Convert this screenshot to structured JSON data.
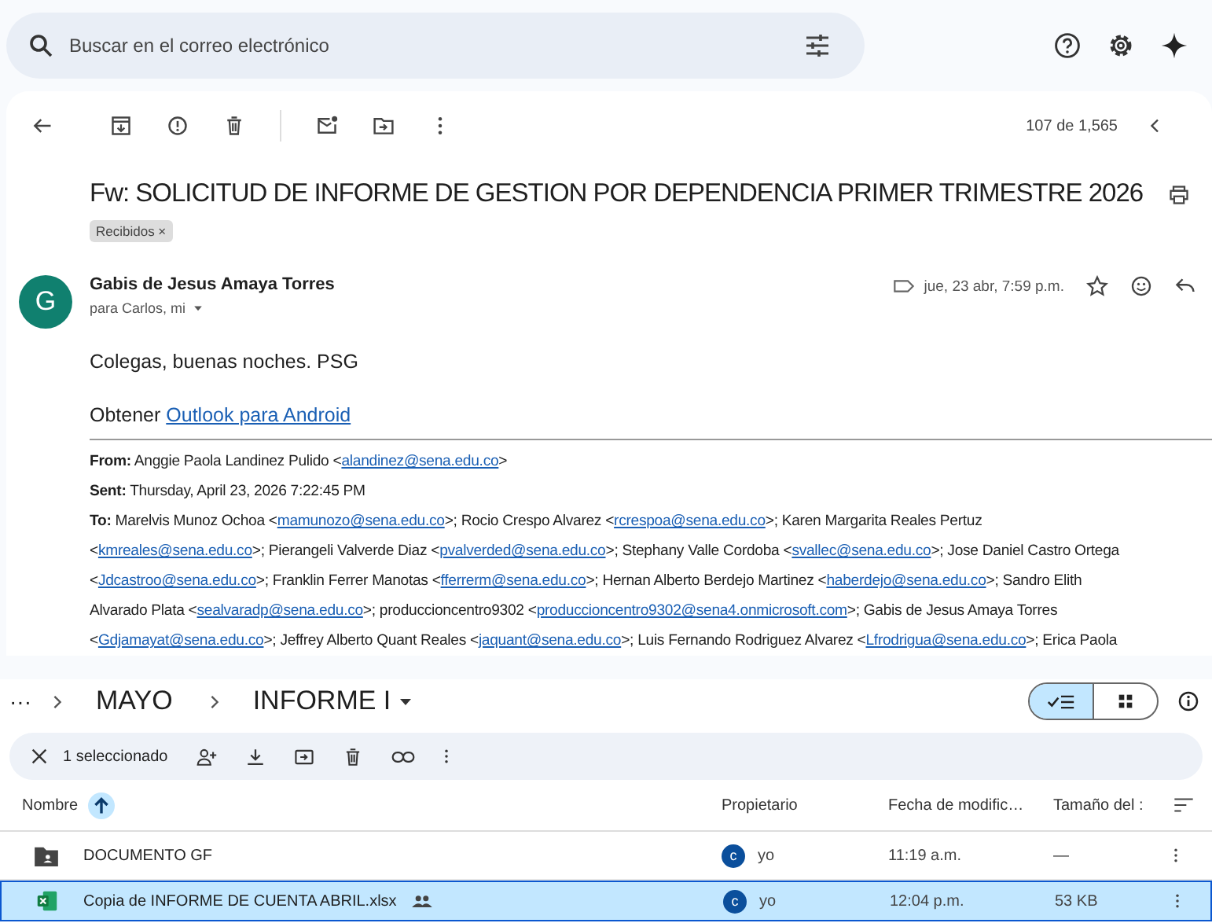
{
  "search": {
    "placeholder": "Buscar en el correo electrónico"
  },
  "toolbar": {
    "counter": "107 de 1,565"
  },
  "email": {
    "subject": "Fw: SOLICITUD DE INFORME DE GESTION POR DEPENDENCIA PRIMER TRIMESTRE 2026",
    "label_chip": {
      "label": "Recibidos",
      "close": "×"
    },
    "sender": {
      "avatar": "G",
      "name": "Gabis de Jesus Amaya Torres",
      "recipients": "para Carlos, mi",
      "date": "jue, 23 abr, 7:59 p.m."
    },
    "greeting": "Colegas, buenas noches. PSG",
    "signature": [
      {
        "kind": "text",
        "text": "Obtener "
      },
      {
        "kind": "link",
        "text": "Outlook para Android"
      }
    ],
    "forward_header": [
      [
        {
          "kind": "label",
          "text": "From:"
        },
        {
          "kind": "text",
          "text": " Anggie Paola Landinez Pulido <"
        },
        {
          "kind": "link",
          "text": "alandinez@sena.edu.co"
        },
        {
          "kind": "text",
          "text": ">"
        }
      ],
      [
        {
          "kind": "label",
          "text": "Sent:"
        },
        {
          "kind": "text",
          "text": " Thursday, April 23, 2026 7:22:45 PM"
        }
      ],
      [
        {
          "kind": "label",
          "text": "To:"
        },
        {
          "kind": "text",
          "text": " Marelvis Munoz Ochoa <"
        },
        {
          "kind": "link",
          "text": "mamunozo@sena.edu.co"
        },
        {
          "kind": "text",
          "text": ">; Rocio Crespo Alvarez <"
        },
        {
          "kind": "link",
          "text": "rcrespoa@sena.edu.co"
        },
        {
          "kind": "text",
          "text": ">; Karen Margarita Reales Pertuz"
        }
      ],
      [
        {
          "kind": "text",
          "text": "<"
        },
        {
          "kind": "link",
          "text": "kmreales@sena.edu.co"
        },
        {
          "kind": "text",
          "text": ">; Pierangeli Valverde Diaz <"
        },
        {
          "kind": "link",
          "text": "pvalverded@sena.edu.co"
        },
        {
          "kind": "text",
          "text": ">; Stephany Valle Cordoba <"
        },
        {
          "kind": "link",
          "text": "svallec@sena.edu.co"
        },
        {
          "kind": "text",
          "text": ">; Jose Daniel Castro Ortega"
        }
      ],
      [
        {
          "kind": "text",
          "text": "<"
        },
        {
          "kind": "link",
          "text": "Jdcastroo@sena.edu.co"
        },
        {
          "kind": "text",
          "text": ">; Franklin Ferrer Manotas <"
        },
        {
          "kind": "link",
          "text": "fferrerm@sena.edu.co"
        },
        {
          "kind": "text",
          "text": ">; Hernan Alberto Berdejo Martinez <"
        },
        {
          "kind": "link",
          "text": "haberdejo@sena.edu.co"
        },
        {
          "kind": "text",
          "text": ">; Sandro Elith"
        }
      ],
      [
        {
          "kind": "text",
          "text": "Alvarado Plata <"
        },
        {
          "kind": "link",
          "text": "sealvaradp@sena.edu.co"
        },
        {
          "kind": "text",
          "text": ">; produccioncentro9302 <"
        },
        {
          "kind": "link",
          "text": "produccioncentro9302@sena4.onmicrosoft.com"
        },
        {
          "kind": "text",
          "text": ">; Gabis de Jesus Amaya Torres"
        }
      ],
      [
        {
          "kind": "text",
          "text": "<"
        },
        {
          "kind": "link",
          "text": "Gdjamayat@sena.edu.co"
        },
        {
          "kind": "text",
          "text": ">; Jeffrey Alberto Quant Reales <"
        },
        {
          "kind": "link",
          "text": "jaquant@sena.edu.co"
        },
        {
          "kind": "text",
          "text": ">; Luis Fernando Rodriguez Alvarez <"
        },
        {
          "kind": "link",
          "text": "Lfrodrigua@sena.edu.co"
        },
        {
          "kind": "text",
          "text": ">; Erica Paola"
        }
      ]
    ]
  },
  "drive": {
    "overflow": "···",
    "breadcrumb": [
      {
        "text": "MAYO",
        "dropdown": false
      },
      {
        "text": "INFORME I",
        "dropdown": true
      }
    ],
    "view": {
      "list_selected": true
    },
    "selection": {
      "count": "1 seleccionado"
    },
    "columns": [
      "Nombre",
      "Propietario",
      "Fecha de modific…",
      "Tamaño del :"
    ],
    "files": [
      {
        "kind": "folder",
        "name": "DOCUMENTO GF",
        "shared": false,
        "owner_initial": "c",
        "owner": "yo",
        "modified": "11:19 a.m.",
        "size": "—",
        "selected": false
      },
      {
        "kind": "sheet",
        "name": "Copia de INFORME DE CUENTA ABRIL.xlsx",
        "shared": true,
        "owner_initial": "c",
        "owner": "yo",
        "modified": "12:04 p.m.",
        "size": "53 KB",
        "selected": true
      }
    ]
  }
}
